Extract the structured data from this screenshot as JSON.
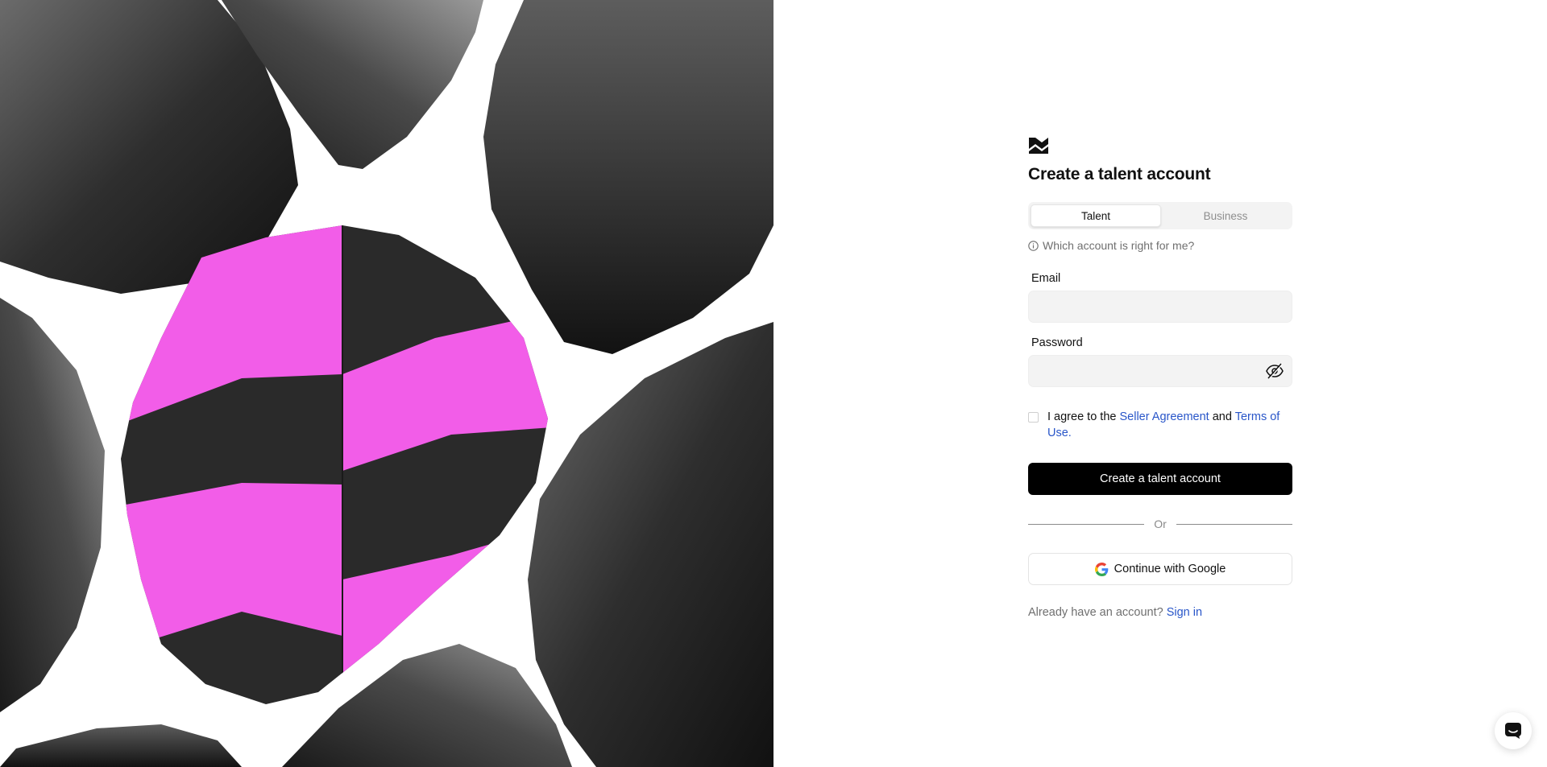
{
  "brand": {
    "logo_icon": "zigzag-logo-icon"
  },
  "hero": {
    "image": "rocks-collage",
    "accent_color": "#f25de8"
  },
  "form": {
    "title": "Create a talent account",
    "tabs": [
      {
        "label": "Talent",
        "active": true
      },
      {
        "label": "Business",
        "active": false
      }
    ],
    "help_icon": "info-icon",
    "help_text": "Which account is right for me?",
    "email": {
      "label": "Email",
      "value": "",
      "placeholder": ""
    },
    "password": {
      "label": "Password",
      "value": "",
      "placeholder": "",
      "toggle_icon": "eye-off-icon"
    },
    "agreement": {
      "checked": false,
      "prefix": "I agree to the ",
      "seller_agreement": "Seller Agreement",
      "middle": " and ",
      "terms": "Terms of Use",
      "suffix": "."
    },
    "submit_label": "Create a talent account",
    "divider_text": "Or",
    "google": {
      "icon": "google-icon",
      "label": "Continue with Google"
    },
    "signin": {
      "prompt": "Already have an account? ",
      "link": "Sign in"
    }
  },
  "chat_widget": {
    "icon": "chat-icon"
  },
  "colors": {
    "link": "#2956c9",
    "primary": "#000000",
    "input_bg": "#f3f3f3"
  }
}
